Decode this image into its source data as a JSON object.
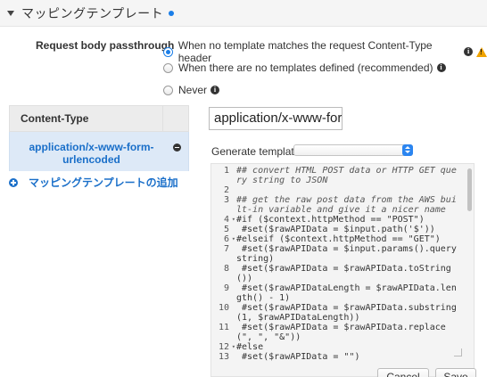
{
  "section": {
    "title": "マッピングテンプレート"
  },
  "passthrough": {
    "label": "Request body passthrough",
    "options": [
      {
        "label": "When no template matches the request Content-Type header",
        "selected": true
      },
      {
        "label": "When there are no templates defined (recommended)",
        "selected": false
      },
      {
        "label": "Never",
        "selected": false
      }
    ]
  },
  "content_type_table": {
    "header": "Content-Type",
    "rows": [
      {
        "label": "application/x-www-form-urlencoded"
      }
    ],
    "add_label": "マッピングテンプレートの追加"
  },
  "content_type_input": {
    "value": "application/x-www-form-urlencoded"
  },
  "generate_template": {
    "label": "Generate template:",
    "selected": ""
  },
  "editor": {
    "lines": [
      {
        "n": "1",
        "fold": "",
        "text": "## convert HTML POST data or HTTP GET query string to JSON",
        "comment": true
      },
      {
        "n": "2",
        "fold": "",
        "text": "",
        "comment": false
      },
      {
        "n": "3",
        "fold": "",
        "text": "## get the raw post data from the AWS built-in variable and give it a nicer name",
        "comment": true
      },
      {
        "n": "4",
        "fold": "▾",
        "text": "#if ($context.httpMethod == \"POST\")",
        "comment": false
      },
      {
        "n": "5",
        "fold": "",
        "text": " #set($rawAPIData = $input.path('$'))",
        "comment": false
      },
      {
        "n": "6",
        "fold": "▾",
        "text": "#elseif ($context.httpMethod == \"GET\")",
        "comment": false
      },
      {
        "n": "7",
        "fold": "",
        "text": " #set($rawAPIData = $input.params().querystring)",
        "comment": false
      },
      {
        "n": "8",
        "fold": "",
        "text": " #set($rawAPIData = $rawAPIData.toString())",
        "comment": false
      },
      {
        "n": "9",
        "fold": "",
        "text": " #set($rawAPIDataLength = $rawAPIData.length() - 1)",
        "comment": false
      },
      {
        "n": "10",
        "fold": "",
        "text": " #set($rawAPIData = $rawAPIData.substring(1, $rawAPIDataLength))",
        "comment": false
      },
      {
        "n": "11",
        "fold": "",
        "text": " #set($rawAPIData = $rawAPIData.replace(\", \", \"&\"))",
        "comment": false
      },
      {
        "n": "12",
        "fold": "▾",
        "text": "#else",
        "comment": false
      },
      {
        "n": "13",
        "fold": "",
        "text": " #set($rawAPIData = \"\")",
        "comment": false
      }
    ]
  },
  "buttons": {
    "cancel": "Cancel",
    "save": "Save"
  }
}
